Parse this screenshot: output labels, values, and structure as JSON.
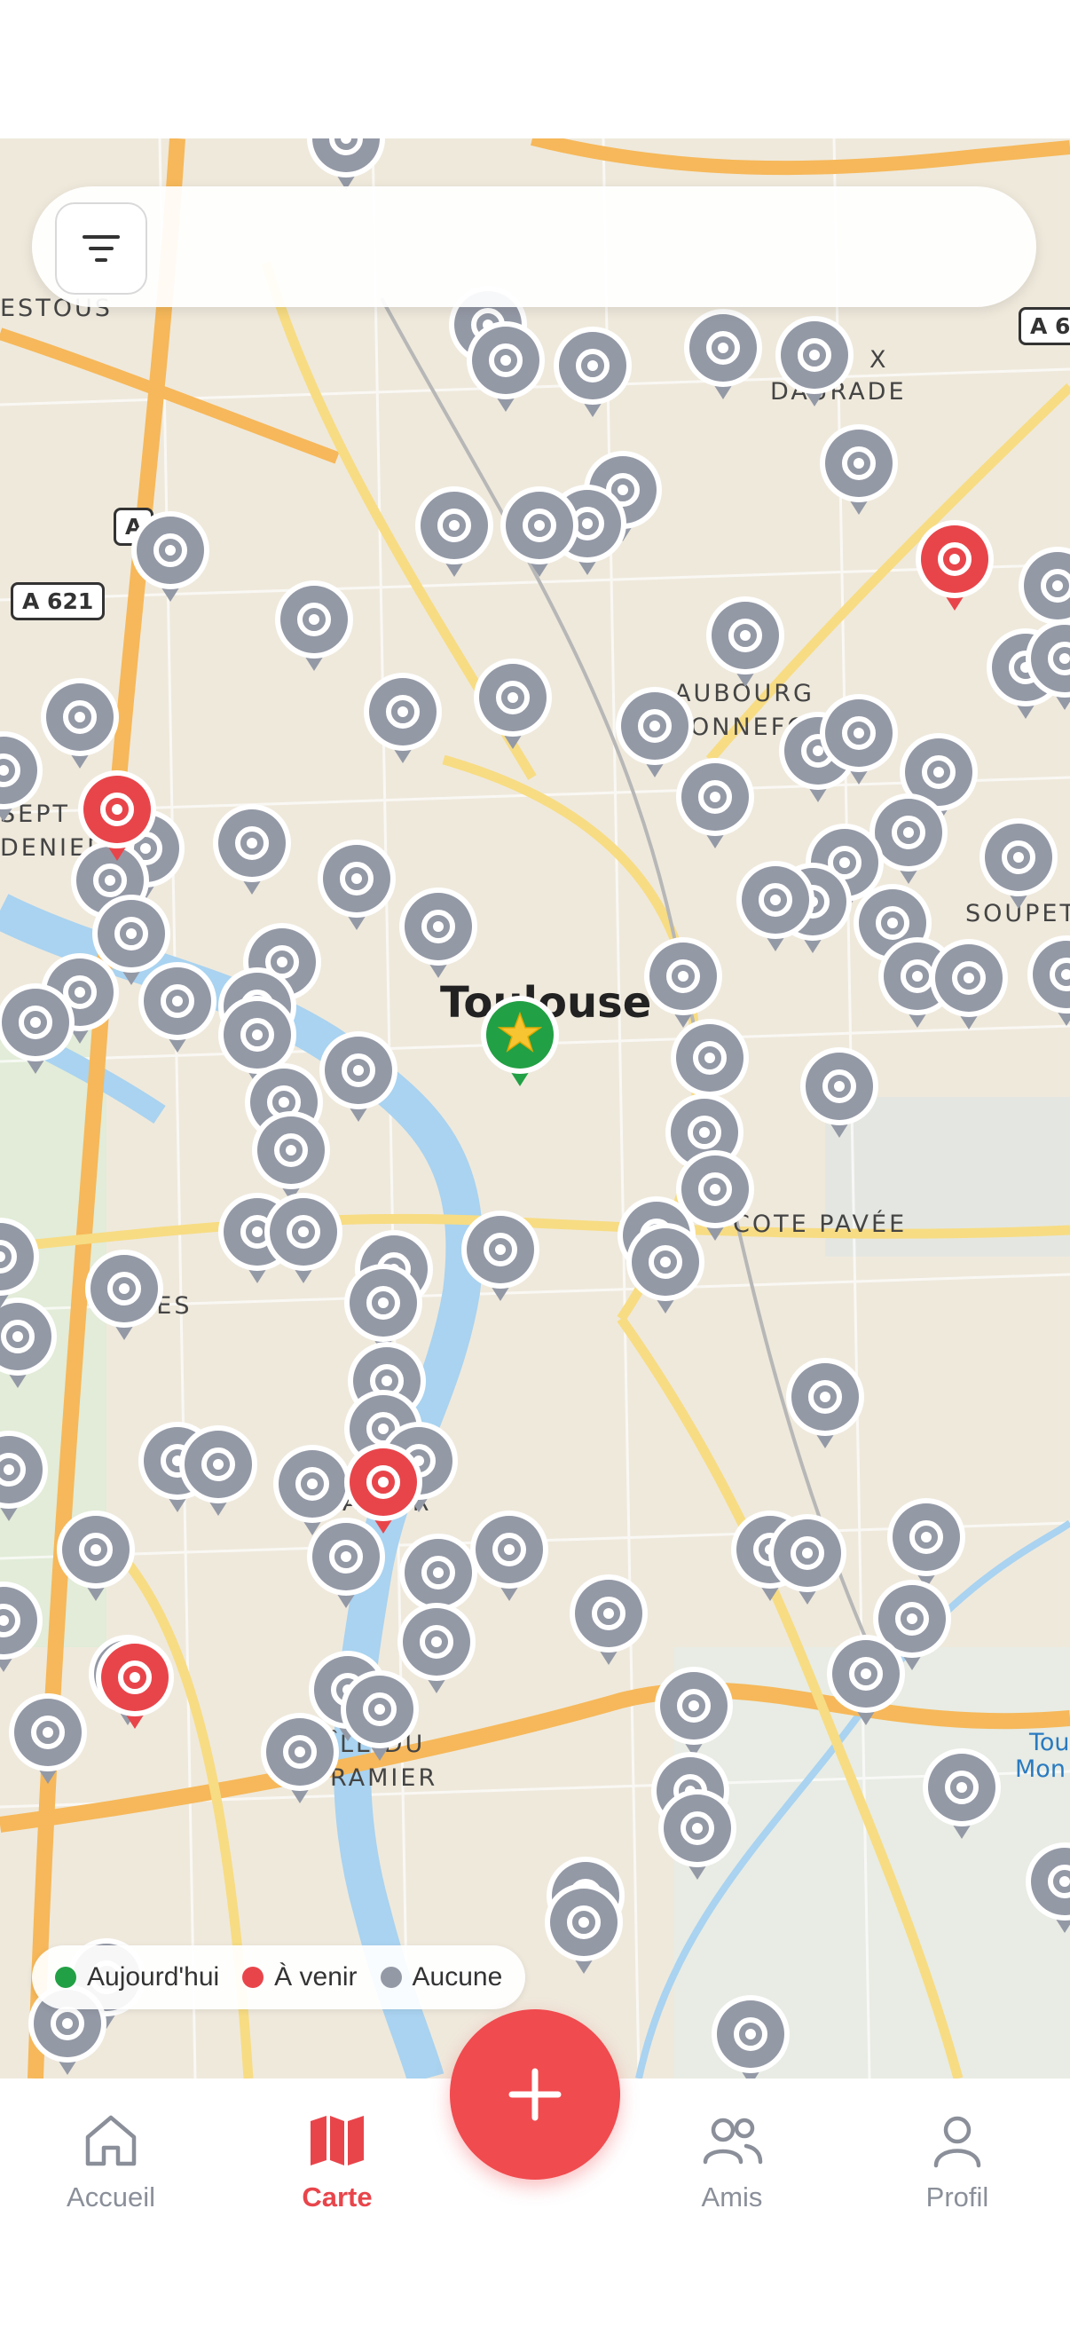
{
  "search": {
    "placeholder": ""
  },
  "map": {
    "city_label": "Toulouse",
    "place_labels": [
      "ESTOUS",
      "X",
      "DAURADE",
      "AUBOURG",
      "ONNEFOY",
      "SEPT",
      "DENIERS",
      "SOUPETARD",
      "COTE PAVÉE",
      "MES",
      "AMIER",
      "ÎLE DU",
      "RAMIER",
      "Tou",
      "Mon"
    ],
    "road_shields": [
      "A 621",
      "A 6",
      "A"
    ]
  },
  "legend": [
    {
      "label": "Aujourd'hui",
      "color": "#22a045"
    },
    {
      "label": "À venir",
      "color": "#e8454b"
    },
    {
      "label": "Aucune",
      "color": "#9499a6"
    }
  ],
  "tabs": [
    {
      "label": "Accueil",
      "icon": "home-icon",
      "active": false
    },
    {
      "label": "Carte",
      "icon": "map-icon",
      "active": true
    },
    {
      "label": "Amis",
      "icon": "users-icon",
      "active": false
    },
    {
      "label": "Profil",
      "icon": "user-icon",
      "active": false
    }
  ],
  "colors": {
    "accent": "#e8454b",
    "pin_gray": "#9499a6",
    "pin_red": "#e8454b",
    "pin_green": "#22a045"
  }
}
